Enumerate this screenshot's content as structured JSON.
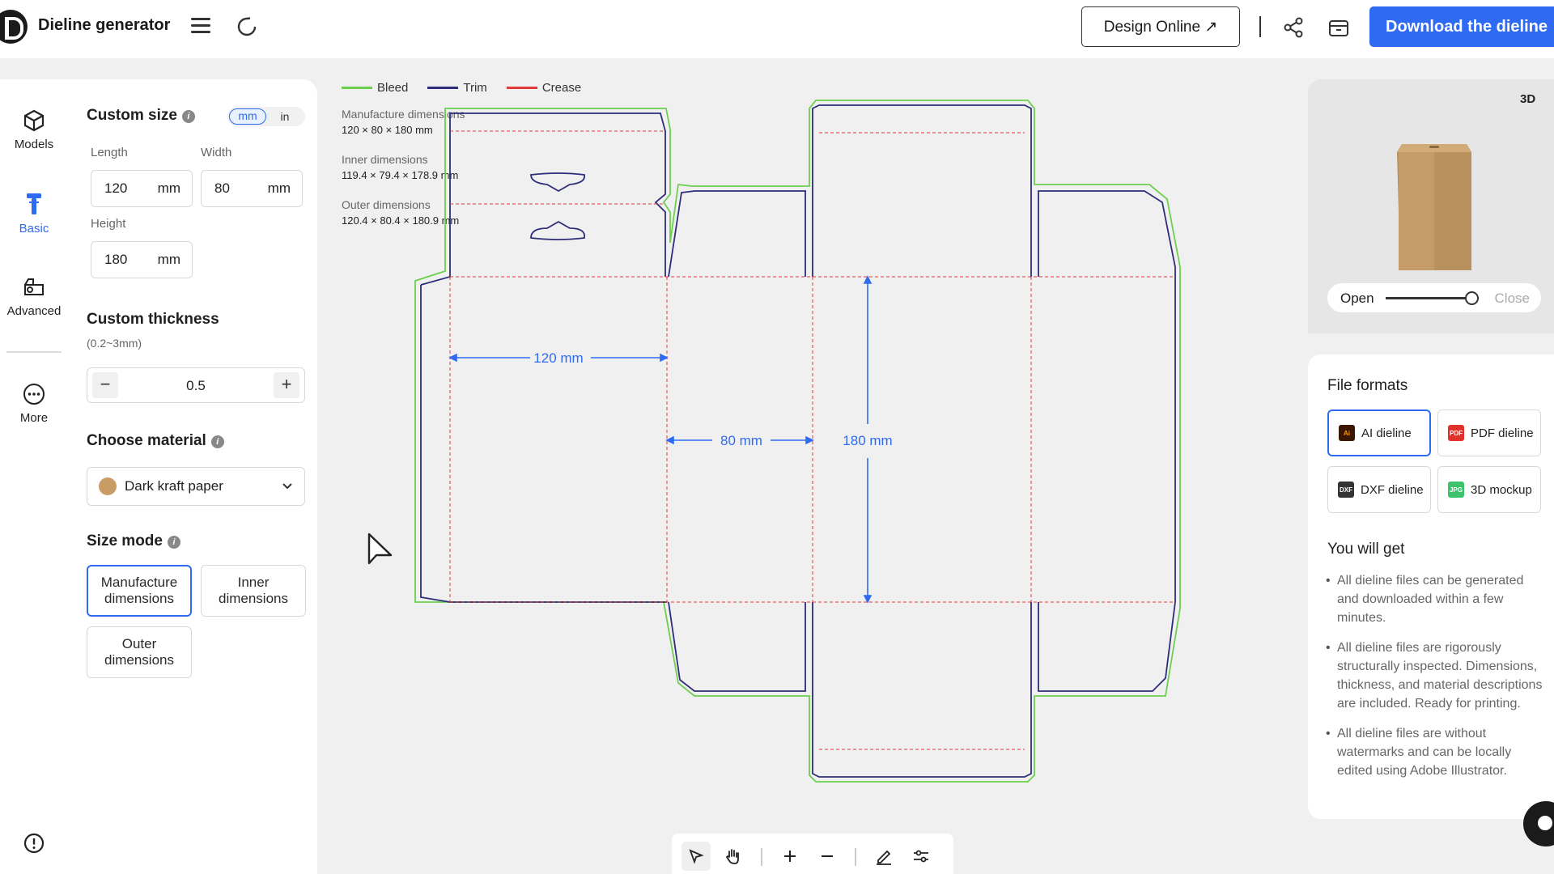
{
  "header": {
    "title": "Dieline generator",
    "design_online": "Design Online ↗",
    "download": "Download the dieline"
  },
  "nav": {
    "models": "Models",
    "basic": "Basic",
    "advanced": "Advanced",
    "more": "More"
  },
  "custom_size": {
    "title": "Custom size",
    "unit_mm": "mm",
    "unit_in": "in",
    "length_label": "Length",
    "length_value": "120",
    "width_label": "Width",
    "width_value": "80",
    "height_label": "Height",
    "height_value": "180",
    "unit": "mm"
  },
  "thickness": {
    "title": "Custom thickness",
    "range": "(0.2~3mm)",
    "value": "0.5",
    "minus": "−",
    "plus": "+"
  },
  "material": {
    "title": "Choose material",
    "value": "Dark kraft paper",
    "swatch_color": "#c99c66"
  },
  "size_mode": {
    "title": "Size mode",
    "manufacture": "Manufacture dimensions",
    "inner": "Inner dimensions",
    "outer": "Outer dimensions"
  },
  "legend": {
    "bleed": "Bleed",
    "trim": "Trim",
    "crease": "Crease",
    "bleed_color": "#6ccf4f",
    "trim_color": "#2d2d7a",
    "crease_color": "#e03a3a"
  },
  "dimensions": {
    "manufacture_label": "Manufacture dimensions",
    "manufacture_value": "120 × 80 × 180 mm",
    "inner_label": "Inner dimensions",
    "inner_value": "119.4 × 79.4 × 178.9 mm",
    "outer_label": "Outer dimensions",
    "outer_value": "120.4 × 80.4 × 180.9 mm"
  },
  "dieline_labels": {
    "length": "120 mm",
    "width": "80 mm",
    "height": "180 mm"
  },
  "preview": {
    "badge": "3D",
    "open": "Open",
    "close": "Close",
    "open_close_level": 0.95
  },
  "formats": {
    "title": "File formats",
    "ai": "AI dieline",
    "pdf": "PDF dieline",
    "dxf": "DXF dieline",
    "mockup": "3D mockup",
    "ai_icon": "Ai",
    "pdf_icon": "PDF",
    "dxf_icon": "DXF",
    "mockup_icon": "JPG"
  },
  "you_will_get": {
    "title": "You will get",
    "items": [
      "All dieline files can be generated and downloaded within a few minutes.",
      "All dieline files are rigorously structurally inspected. Dimensions, thickness, and material descriptions are included. Ready for printing.",
      "All dieline files are without watermarks and can be locally edited using Adobe Illustrator."
    ]
  },
  "colors": {
    "accent": "#2f6bf2"
  }
}
